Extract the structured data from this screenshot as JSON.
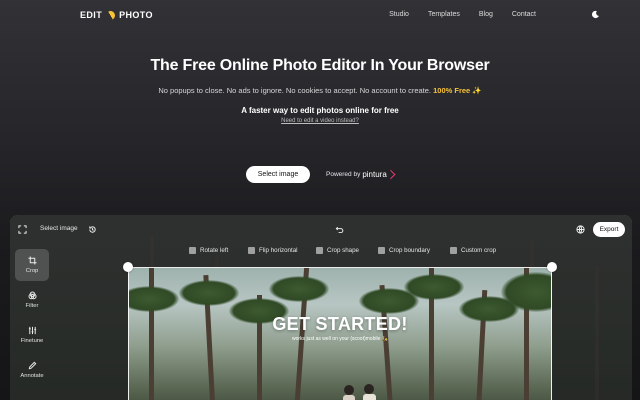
{
  "nav": {
    "logo_left": "EDIT",
    "logo_right": "PHOTO",
    "links": [
      "Studio",
      "Templates",
      "Blog",
      "Contact"
    ],
    "theme_icon": "moon-icon"
  },
  "hero": {
    "title": "The Free Online Photo Editor In Your Browser",
    "subtitle": "No popups to close. No ads to ignore. No cookies to accept. No account to create.",
    "highlight": "100% Free ✨",
    "tagline": "A faster way to edit photos online for free",
    "video_link": "Need to edit a video instead?",
    "select_button": "Select image",
    "powered_by": "Powered by",
    "powered_brand": "pintura"
  },
  "editor": {
    "topbar": {
      "select_image": "Select image",
      "export": "Export"
    },
    "tools": [
      {
        "label": "Rotate left",
        "icon": "rotate-left-icon"
      },
      {
        "label": "Flip horizontal",
        "icon": "flip-horizontal-icon"
      },
      {
        "label": "Crop shape",
        "icon": "crop-shape-icon"
      },
      {
        "label": "Crop boundary",
        "icon": "crop-boundary-icon"
      },
      {
        "label": "Custom crop",
        "icon": "custom-crop-icon"
      }
    ],
    "sidebar": [
      {
        "label": "Crop",
        "icon": "crop-icon",
        "active": true
      },
      {
        "label": "Filter",
        "icon": "filter-icon",
        "active": false
      },
      {
        "label": "Finetune",
        "icon": "finetune-icon",
        "active": false
      },
      {
        "label": "Annotate",
        "icon": "annotate-icon",
        "active": false
      }
    ],
    "canvas": {
      "headline": "GET STARTED!",
      "caption": "works just as well on your (scoot)mobile 🛵"
    }
  },
  "colors": {
    "accent": "#f7c236",
    "brand_pink": "#e23a6b",
    "background": "#26262a"
  }
}
